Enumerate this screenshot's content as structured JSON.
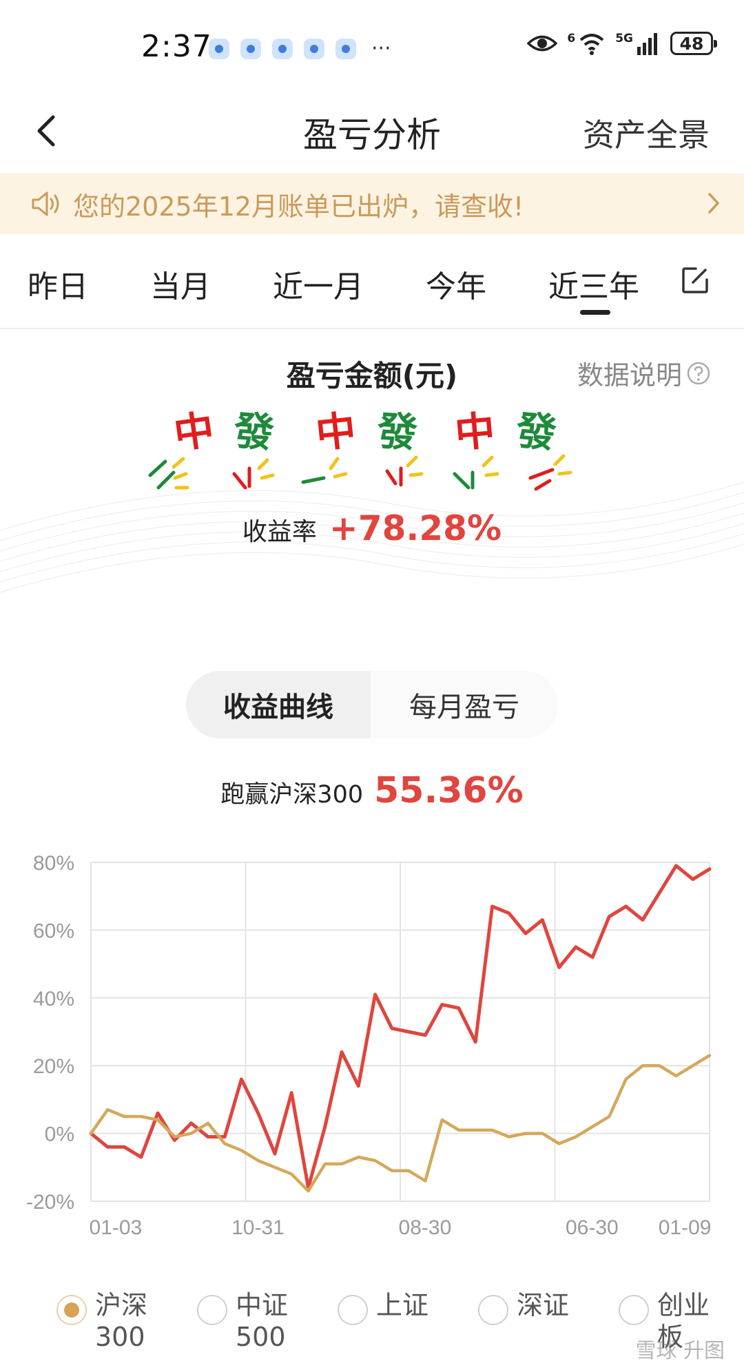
{
  "status_bar": {
    "time": "2:37",
    "network": "5G",
    "wifi_tag": "6",
    "battery": "48"
  },
  "nav": {
    "title": "盈亏分析",
    "right_label": "资产全景"
  },
  "notice": {
    "text": "您的2025年12月账单已出炉，请查收!"
  },
  "tabs": {
    "items": [
      {
        "label": "昨日"
      },
      {
        "label": "当月"
      },
      {
        "label": "近一月"
      },
      {
        "label": "今年"
      },
      {
        "label": "近三年"
      }
    ],
    "active": "近三年"
  },
  "profit": {
    "title": "盈亏金额(元)",
    "note": "数据说明",
    "rate_label": "收益率",
    "rate_value": "+78.28%",
    "hidden_amount_glyphs": [
      "中",
      "發",
      "中",
      "發",
      "中",
      "發"
    ]
  },
  "segmented": {
    "active": "收益曲线",
    "inactive": "每月盈亏"
  },
  "beat": {
    "label": "跑赢沪深300",
    "value": "55.36%"
  },
  "chart_data": {
    "type": "line",
    "x_tick_labels": [
      "01-03",
      "10-31",
      "08-30",
      "06-30",
      "01-09"
    ],
    "y_tick_labels": [
      "80%",
      "60%",
      "40%",
      "20%",
      "0%",
      "-20%"
    ],
    "ylim": [
      -20,
      80
    ],
    "grid": true,
    "x_count": 40,
    "series": [
      {
        "name": "",
        "color": "#e0453e",
        "values": [
          0,
          -4,
          -4,
          -7,
          6,
          -2,
          3,
          -1,
          -1,
          16,
          6,
          -6,
          12,
          -16,
          2,
          24,
          14,
          41,
          31,
          30,
          29,
          38,
          37,
          27,
          67,
          65,
          59,
          63,
          49,
          55,
          52,
          64,
          67,
          63,
          71,
          79,
          75,
          78
        ]
      },
      {
        "name": "沪深300",
        "color": "#d4a85a",
        "values": [
          0,
          7,
          5,
          5,
          4,
          -1,
          0,
          3,
          -3,
          -5,
          -8,
          -10,
          -12,
          -17,
          -9,
          -9,
          -7,
          -8,
          -11,
          -11,
          -14,
          4,
          1,
          1,
          1,
          -1,
          0,
          0,
          -3,
          -1,
          2,
          5,
          16,
          20,
          20,
          17,
          20,
          23
        ]
      }
    ]
  },
  "legend": [
    {
      "label": "沪深300",
      "checked": true
    },
    {
      "label": "中证500",
      "checked": false
    },
    {
      "label": "上证",
      "checked": false
    },
    {
      "label": "深证",
      "checked": false
    },
    {
      "label": "创业板",
      "checked": false
    }
  ],
  "watermark": "雪球 升图",
  "colors": {
    "accent_red": "#e0453e",
    "benchmark_gold": "#d4a85a",
    "notice_bg": "#fdf3e2",
    "notice_text": "#c89a5a"
  }
}
